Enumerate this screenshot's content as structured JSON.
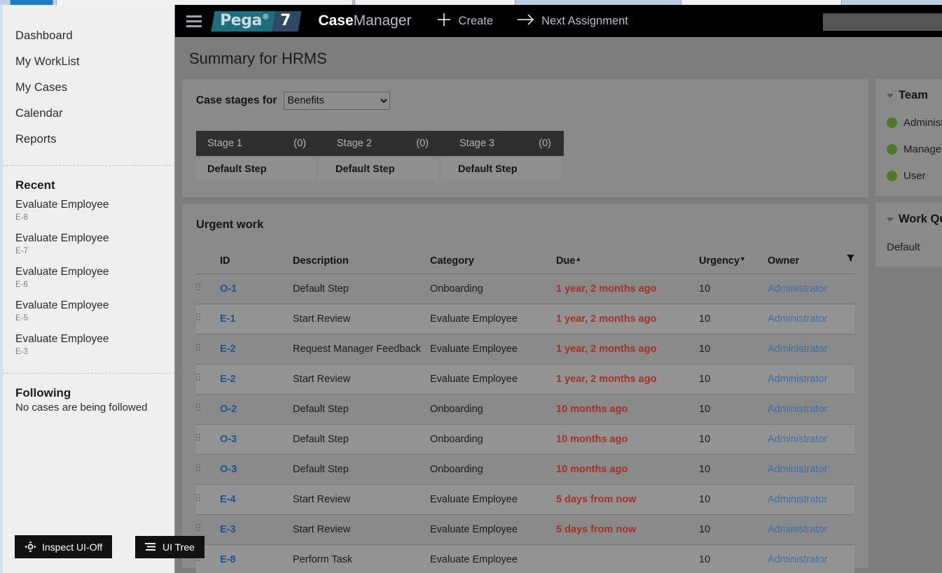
{
  "browser": {
    "tabs_visible": 5
  },
  "sidebar": {
    "nav": [
      {
        "label": "Dashboard"
      },
      {
        "label": "My WorkList"
      },
      {
        "label": "My Cases"
      },
      {
        "label": "Calendar"
      },
      {
        "label": "Reports"
      }
    ],
    "recent": {
      "title": "Recent",
      "items": [
        {
          "title": "Evaluate Employee",
          "id": "E-8"
        },
        {
          "title": "Evaluate Employee",
          "id": "E-7"
        },
        {
          "title": "Evaluate Employee",
          "id": "E-6"
        },
        {
          "title": "Evaluate Employee",
          "id": "E-5"
        },
        {
          "title": "Evaluate Employee",
          "id": "E-3"
        }
      ]
    },
    "following": {
      "title": "Following",
      "empty_text": "No cases are being followed"
    }
  },
  "overlay_buttons": {
    "inspect": "Inspect UI-Off",
    "ui_tree": "UI Tree"
  },
  "header": {
    "logo_pega": "Pega",
    "logo_reg": "®",
    "logo_seven": "7",
    "app_name_bold": "Case",
    "app_name_light": "Manager",
    "create_label": "Create",
    "next_assignment_label": "Next Assignment",
    "search_placeholder": "",
    "search_value": ""
  },
  "page": {
    "title": "Summary for HRMS"
  },
  "stages_card": {
    "label": "Case stages for",
    "selected": "Benefits",
    "options": [
      "Benefits"
    ],
    "stages": [
      {
        "name": "Stage 1",
        "count": "(0)",
        "step": "Default Step"
      },
      {
        "name": "Stage 2",
        "count": "(0)",
        "step": "Default Step"
      },
      {
        "name": "Stage 3",
        "count": "(0)",
        "step": "Default Step"
      }
    ]
  },
  "urgent_work": {
    "title": "Urgent work",
    "columns": [
      {
        "key": "id",
        "label": "ID",
        "sort": ""
      },
      {
        "key": "description",
        "label": "Description",
        "sort": ""
      },
      {
        "key": "category",
        "label": "Category",
        "sort": ""
      },
      {
        "key": "due",
        "label": "Due",
        "sort": "▲"
      },
      {
        "key": "urgency",
        "label": "Urgency",
        "sort": "▼"
      },
      {
        "key": "owner",
        "label": "Owner",
        "sort": ""
      }
    ],
    "rows": [
      {
        "id": "O-1",
        "description": "Default Step",
        "category": "Onboarding",
        "due": "1 year, 2 months ago",
        "urgency": "10",
        "owner": "Administrator"
      },
      {
        "id": "E-1",
        "description": "Start Review",
        "category": "Evaluate Employee",
        "due": "1 year, 2 months ago",
        "urgency": "10",
        "owner": "Administrator"
      },
      {
        "id": "E-2",
        "description": "Request Manager Feedback",
        "category": "Evaluate Employee",
        "due": "1 year, 2 months ago",
        "urgency": "10",
        "owner": "Administrator"
      },
      {
        "id": "E-2",
        "description": "Start Review",
        "category": "Evaluate Employee",
        "due": "1 year, 2 months ago",
        "urgency": "10",
        "owner": "Administrator"
      },
      {
        "id": "O-2",
        "description": "Default Step",
        "category": "Onboarding",
        "due": "10 months ago",
        "urgency": "10",
        "owner": "Administrator"
      },
      {
        "id": "O-3",
        "description": "Default Step",
        "category": "Onboarding",
        "due": "10 months ago",
        "urgency": "10",
        "owner": "Administrator"
      },
      {
        "id": "O-3",
        "description": "Default Step",
        "category": "Onboarding",
        "due": "10 months ago",
        "urgency": "10",
        "owner": "Administrator"
      },
      {
        "id": "E-4",
        "description": "Start Review",
        "category": "Evaluate Employee",
        "due": "5 days from now",
        "urgency": "10",
        "owner": "Administrator"
      },
      {
        "id": "E-3",
        "description": "Start Review",
        "category": "Evaluate Employee",
        "due": "5 days from now",
        "urgency": "10",
        "owner": "Administrator"
      },
      {
        "id": "E-8",
        "description": "Perform Task",
        "category": "Evaluate Employee",
        "due": "",
        "urgency": "10",
        "owner": "Administrator"
      }
    ]
  },
  "right_panels": [
    {
      "title": "Team",
      "members": [
        {
          "name": "Administrator",
          "status_color": "#4e7a26"
        },
        {
          "name": "Manager",
          "status_color": "#4e7a26"
        },
        {
          "name": "User",
          "status_color": "#4e7a26"
        }
      ]
    },
    {
      "title": "Work Queues",
      "body": "Default"
    }
  ],
  "colors": {
    "header_bg": "#000000",
    "app_bg": "#7d7d7d",
    "card_bg": "#8a8a8a",
    "stage_head_bg": "#2f2f2f",
    "id_link": "#1a5490",
    "due_overdue": "#a33227",
    "owner_link": "#3c6fa8",
    "status_green": "#4e7a26",
    "logo_teal": "#1e6f7e",
    "logo_navy": "#2c4a63"
  }
}
